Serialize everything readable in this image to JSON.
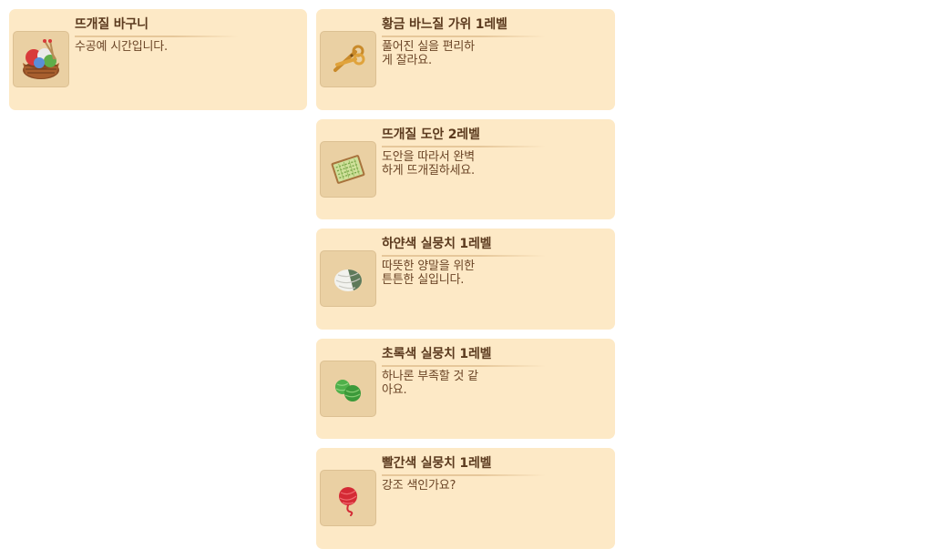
{
  "items": [
    {
      "title": "뜨개질 바구니",
      "description": "수공예 시간입니다.",
      "icon": "yarn-basket-icon"
    },
    {
      "title": "황금 바느질 가위 1레벨",
      "description_lines": [
        "풀어진 실을 편리하",
        "게 잘라요."
      ],
      "icon": "golden-scissors-icon"
    },
    {
      "title": "뜨개질 도안 2레벨",
      "description_lines": [
        "도안을 따라서 완벽",
        "하게 뜨개질하세요."
      ],
      "icon": "knitting-pattern-icon"
    },
    {
      "title": "하얀색 실뭉치 1레벨",
      "description_lines": [
        "따뜻한 양말을 위한",
        "튼튼한 실입니다."
      ],
      "icon": "white-yarn-ball-icon"
    },
    {
      "title": "초록색 실뭉치 1레벨",
      "description_lines": [
        "하나론 부족할 것 같",
        "아요."
      ],
      "icon": "green-yarn-balls-icon"
    },
    {
      "title": "빨간색 실뭉치 1레벨",
      "description": "강조 색인가요?",
      "icon": "red-yarn-ball-icon"
    }
  ],
  "colors": {
    "card_background": "#fde9c6",
    "icon_background": "#ead0a3",
    "title_text": "#5b3a1e",
    "description_text": "#6a4426"
  }
}
